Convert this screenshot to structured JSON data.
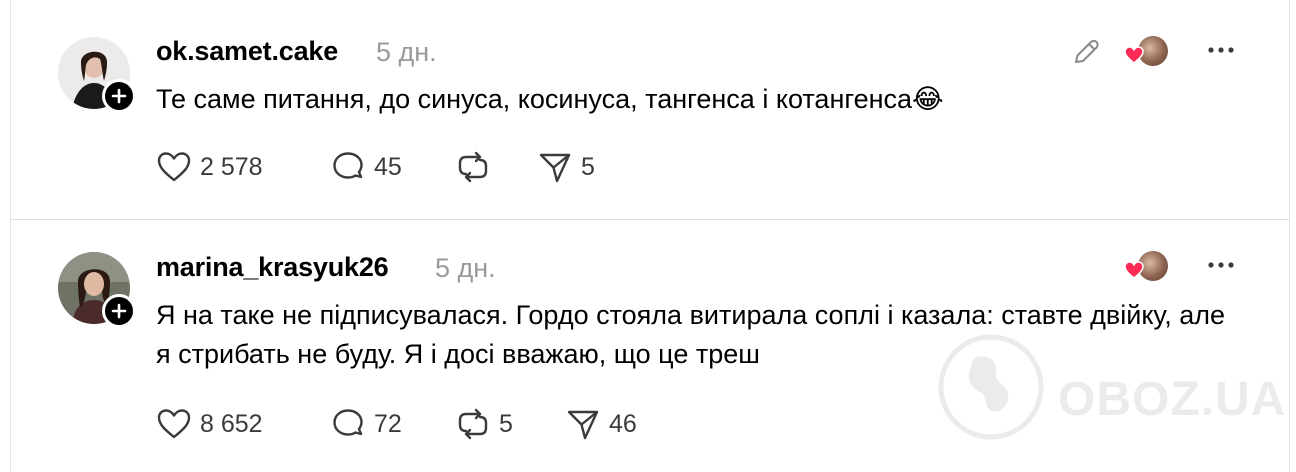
{
  "posts": [
    {
      "username": "ok.samet.cake",
      "time": "5 дн.",
      "text": "Те саме питання, до синуса, косинуса, тангенса і котангенса😂",
      "likes": "2 578",
      "comments": "45",
      "reposts": "",
      "shares": "5",
      "has_edit_icon": true
    },
    {
      "username": "marina_krasyuk26",
      "time": "5 дн.",
      "text": "Я на таке не підписувалася. Гордо стояла витирала соплі і казала: ставте двійку, але я стрибать не буду. Я і досі вважаю, що це треш",
      "likes": "8 652",
      "comments": "72",
      "reposts": "5",
      "shares": "46",
      "has_edit_icon": false
    }
  ],
  "watermark": "OBOZ.UA",
  "colors": {
    "accent_heart": "#ff2a55",
    "muted_text": "#9a9a9a",
    "icon": "#3b3b3b"
  },
  "icons": [
    "heart-icon",
    "comment-icon",
    "repost-icon",
    "share-icon",
    "edit-icon",
    "more-icon",
    "plus-icon"
  ]
}
